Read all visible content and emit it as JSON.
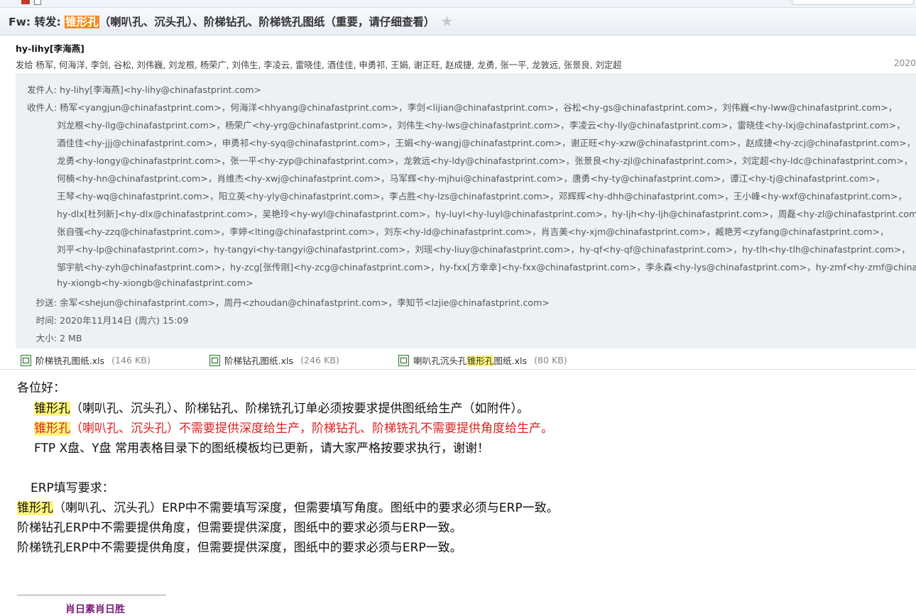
{
  "subject": {
    "prefix": "Fw: 转发: ",
    "highlight": "锥形孔",
    "rest": "（喇叭孔、沉头孔）、阶梯钻孔、阶梯铣孔图纸（重要，请仔细查看）",
    "star_icon": "star-icon"
  },
  "header": {
    "from": "hy-lihy[李海燕]",
    "to_summary": "发给 杨军, 何海洋, 李剑, 谷松, 刘伟巍, 刘龙根, 杨荣广, 刘伟生, 李凌云, 雷晓佳, 酒佳佳, 申勇祁, 王娟, 谢正旺, 赵成捷, 龙勇, 张一平, 龙敦远, 张景良, 刘定超",
    "date_truncated": "2020"
  },
  "details": {
    "sender_label": "发件人:",
    "sender": "hy-lihy[李海燕]<hy-lihy@chinafastprint.com>",
    "to_label": "收件人:",
    "to_lines": [
      "杨军<yangjun@chinafastprint.com>，何海洋<hhyang@chinafastprint.com>，李剑<lijian@chinafastprint.com>，谷松<hy-gs@chinafastprint.com>，刘伟巍<hy-lww@chinafastprint.com>，",
      "刘龙根<hy-llg@chinafastprint.com>，杨荣广<hy-yrg@chinafastprint.com>，刘伟生<hy-lws@chinafastprint.com>，李凌云<hy-lly@chinafastprint.com>，雷晓佳<hy-lxj@chinafastprint.com>，",
      "酒佳佳<hy-jjj@chinafastprint.com>，申勇祁<hy-syq@chinafastprint.com>，王娟<hy-wangj@chinafastprint.com>，谢正旺<hy-xzw@chinafastprint.com>，赵成捷<hy-zcj@chinafastprint.com>，",
      "龙勇<hy-longy@chinafastprint.com>，张一平<hy-zyp@chinafastprint.com>，龙敦远<hy-ldy@chinafastprint.com>，张景良<hy-zjl@chinafastprint.com>，刘定超<hy-ldc@chinafastprint.com>，",
      "何楠<hy-hn@chinafastprint.com>，肖维杰<hy-xwj@chinafastprint.com>，马军辉<hy-mjhui@chinafastprint.com>，唐勇<hy-ty@chinafastprint.com>，谭江<hy-tj@chinafastprint.com>，",
      "王琴<hy-wq@chinafastprint.com>，阳立英<hy-yly@chinafastprint.com>，李占胜<hy-lzs@chinafastprint.com>，邓辉辉<hy-dhh@chinafastprint.com>，王小峰<hy-wxf@chinafastprint.com>，",
      "hy-dlx[杜列新]<hy-dlx@chinafastprint.com>，吴艳玲<hy-wyl@chinafastprint.com>，hy-luyl<hy-luyl@chinafastprint.com>，hy-ljh<hy-ljh@chinafastprint.com>，周磊<hy-zl@chinafastprint.com>，",
      "张自强<hy-zzq@chinafastprint.com>，李婷<lting@chinafastprint.com>，刘东<hy-ld@chinafastprint.com>，肖吉美<hy-xjm@chinafastprint.com>，臧艳芳<zyfang@chinafastprint.com>，",
      "刘平<hy-lp@chinafastprint.com>，hy-tangyi<hy-tangyi@chinafastprint.com>，刘瑶<hy-liuy@chinafastprint.com>，hy-qf<hy-qf@chinafastprint.com>，hy-tlh<hy-tlh@chinafastprint.com>，",
      "邹宇航<hy-zyh@chinafastprint.com>，hy-zcg[张传刚]<hy-zcg@chinafastprint.com>，hy-fxx[方幸幸]<hy-fxx@chinafastprint.com>，李永森<hy-lys@chinafastprint.com>，hy-zmf<hy-zmf@chinafas",
      "hy-xiongb<hy-xiongb@chinafastprint.com>"
    ],
    "cc_label": "抄送:",
    "cc": "余军<shejun@chinafastprint.com>，周丹<zhoudan@chinafastprint.com>，李知节<lzjie@chinafastprint.com>",
    "time_label": "时间:",
    "time": "2020年11月14日 (周六) 15:09",
    "size_label": "大小:",
    "size": "2 MB"
  },
  "attachments": [
    {
      "name": "阶梯铣孔图纸.xls",
      "size": "(146 KB)",
      "icon": "excel-file-icon"
    },
    {
      "name": "阶梯钻孔图纸.xls",
      "size": "(246 KB)",
      "icon": "excel-file-icon"
    },
    {
      "name_pre": "喇叭孔沉头孔",
      "name_hl": "锥形孔",
      "name_post": "图纸.xls",
      "size": "(80 KB)",
      "icon": "excel-file-icon"
    }
  ],
  "body": {
    "greeting": "各位好：",
    "line1_hl": "锥形孔",
    "line1_rest": "（喇叭孔、沉头孔）、阶梯钻孔、阶梯铣孔订单必须按要求提供图纸给生产（如附件）。",
    "line2_hl": "锥形孔",
    "line2_rest": "（喇叭孔、沉头孔）不需要提供深度给生产，阶梯钻孔、阶梯铣孔不需要提供角度给生产。",
    "line3": "FTP X盘、Y盘 常用表格目录下的图纸模板均已更新，请大家严格按要求执行，谢谢！",
    "erp_heading": "ERP填写要求：",
    "erp1_hl": "锥形孔",
    "erp1_rest": "（喇叭孔、沉头孔）ERP中不需要填写深度，但需要填写角度。图纸中的要求必须与ERP一致。",
    "erp2": "阶梯钻孔ERP中不需要提供角度，但需要提供深度，图纸中的要求必须与ERP一致。",
    "erp3": "阶梯铣孔ERP中不需要提供角度，但需要提供深度，图纸中的要求必须与ERP一致。",
    "signature": "肖日素肖日胜"
  },
  "colors": {
    "subject_highlight": "#f58a1f",
    "search_highlight": "#fff579",
    "warning_red": "#e02020",
    "detail_bg": "#eef1f3"
  }
}
